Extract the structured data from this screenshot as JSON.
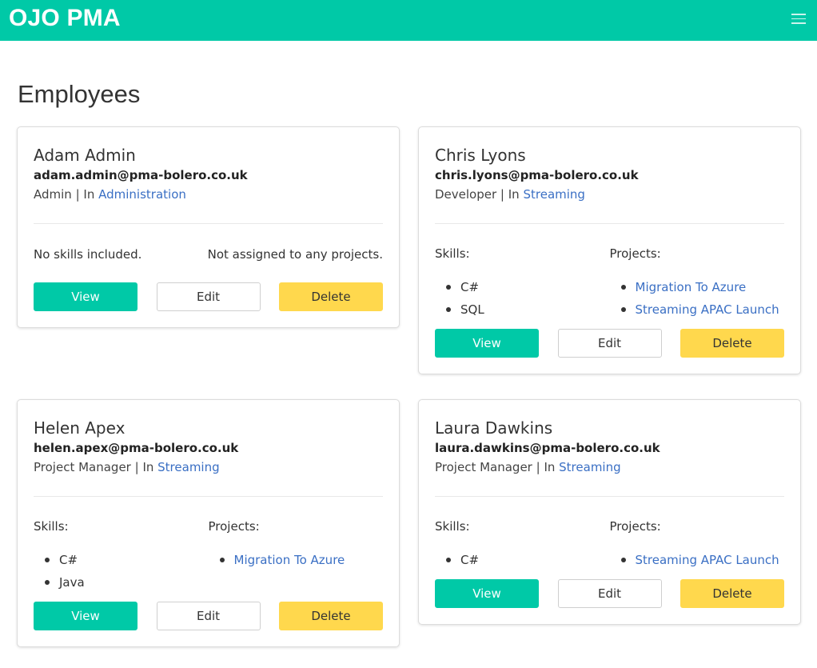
{
  "app": {
    "brand": "OJO PMA",
    "menu_icon": "hamburger-menu-icon"
  },
  "page": {
    "title": "Employees"
  },
  "colors": {
    "accent": "#00c9a7",
    "delete": "#ffd84d",
    "link": "#3a6fc4"
  },
  "employees": [
    {
      "name": "Adam Admin",
      "email": "adam.admin@pma-bolero.co.uk",
      "role": "Admin",
      "in_label": "In",
      "department": "Administration",
      "skills_label": "",
      "projects_label": "",
      "no_skills": "No skills included.",
      "no_projects": "Not assigned to any projects.",
      "skills": [],
      "projects": [],
      "buttons": {
        "view": "View",
        "edit": "Edit",
        "delete": "Delete"
      }
    },
    {
      "name": "Chris Lyons",
      "email": "chris.lyons@pma-bolero.co.uk",
      "role": "Developer",
      "in_label": "In",
      "department": "Streaming",
      "skills_label": "Skills:",
      "projects_label": "Projects:",
      "skills": [
        "C#",
        "SQL"
      ],
      "projects": [
        "Migration To Azure",
        "Streaming APAC Launch"
      ],
      "buttons": {
        "view": "View",
        "edit": "Edit",
        "delete": "Delete"
      }
    },
    {
      "name": "Helen Apex",
      "email": "helen.apex@pma-bolero.co.uk",
      "role": "Project Manager",
      "in_label": "In",
      "department": "Streaming",
      "skills_label": "Skills:",
      "projects_label": "Projects:",
      "skills": [
        "C#",
        "Java"
      ],
      "projects": [
        "Migration To Azure"
      ],
      "buttons": {
        "view": "View",
        "edit": "Edit",
        "delete": "Delete"
      }
    },
    {
      "name": "Laura Dawkins",
      "email": "laura.dawkins@pma-bolero.co.uk",
      "role": "Project Manager",
      "in_label": "In",
      "department": "Streaming",
      "skills_label": "Skills:",
      "projects_label": "Projects:",
      "skills": [
        "C#"
      ],
      "projects": [
        "Streaming APAC Launch"
      ],
      "buttons": {
        "view": "View",
        "edit": "Edit",
        "delete": "Delete"
      }
    }
  ]
}
